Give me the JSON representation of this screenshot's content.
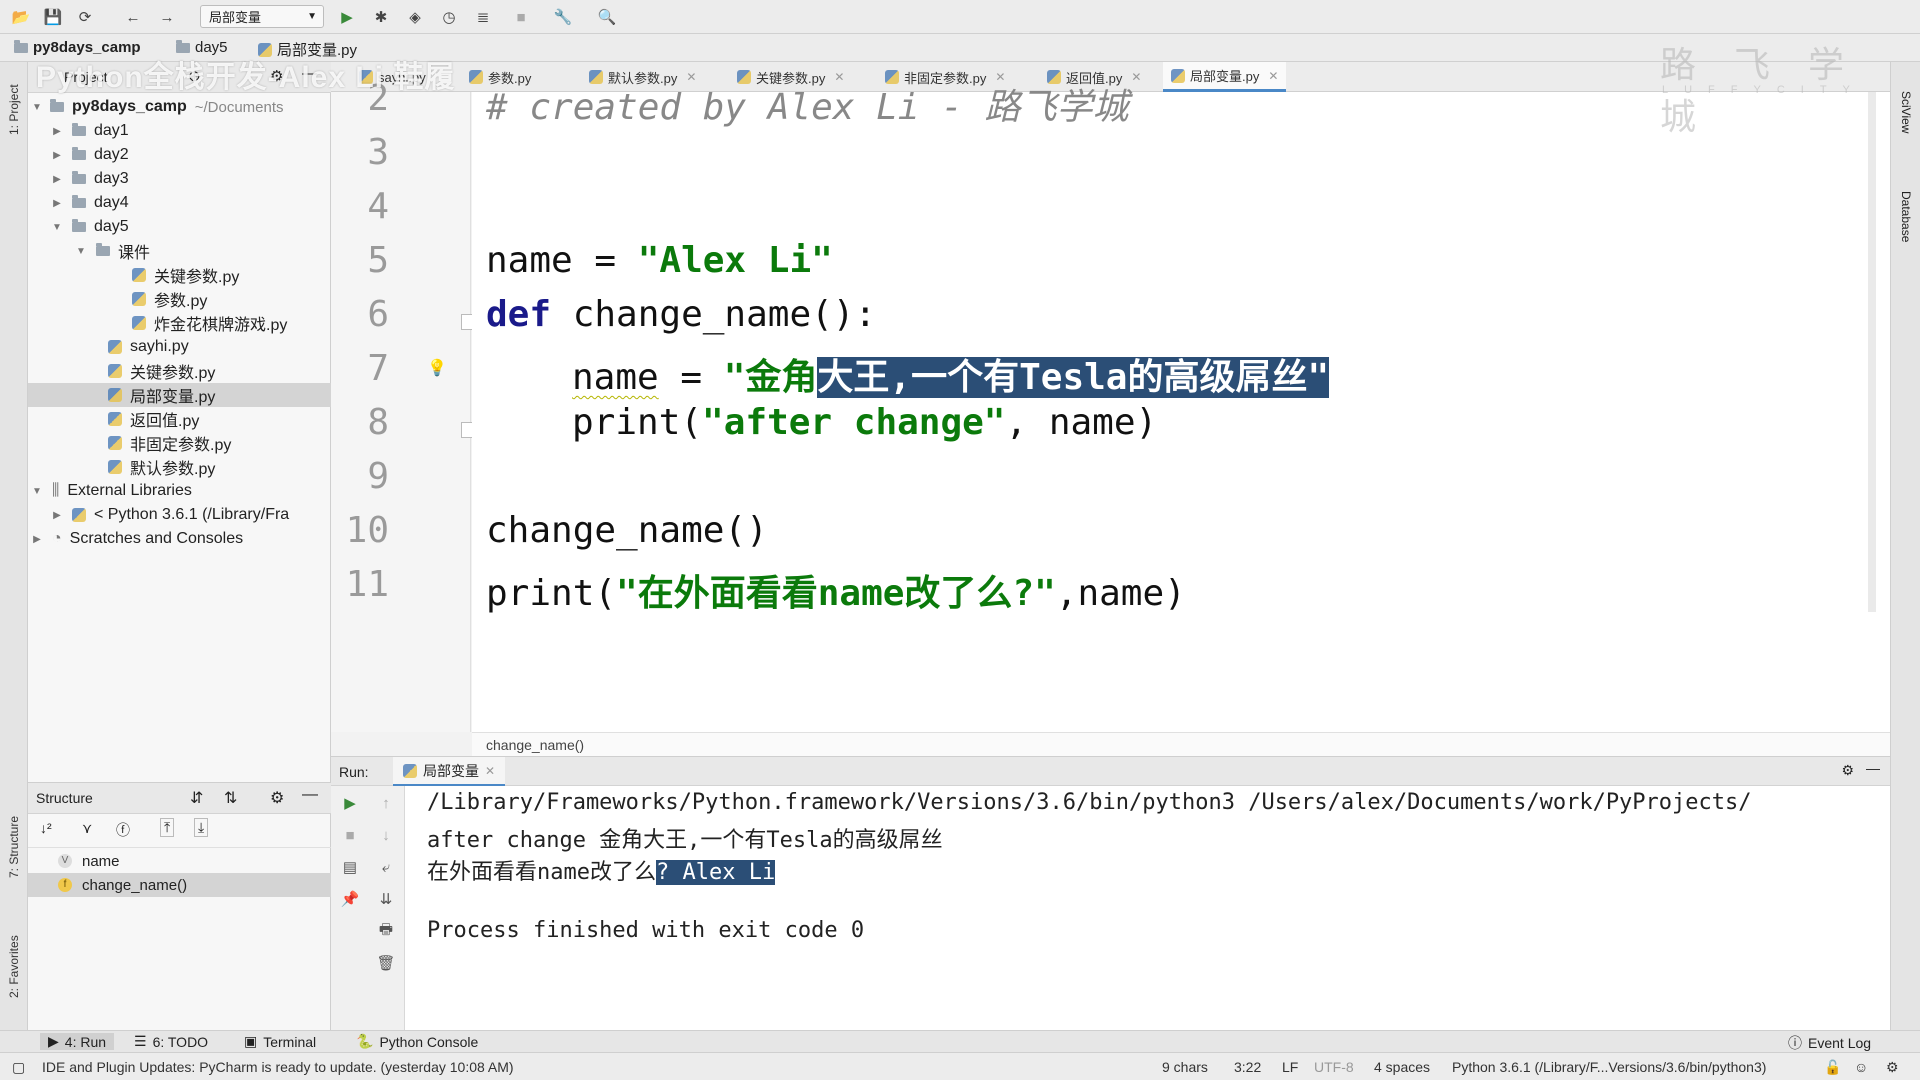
{
  "toolbar": {
    "run_config": "局部变量",
    "icons": [
      "open-folder-icon",
      "save-icon",
      "sync-icon",
      "back-icon",
      "forward-icon",
      "run-icon",
      "debug-icon",
      "coverage-icon",
      "profile-icon",
      "concurrency-icon",
      "stop-icon",
      "settings-wrench-icon",
      "search-icon"
    ]
  },
  "breadcrumb": {
    "project": "py8days_camp",
    "folder": "day5",
    "file": "局部变量.py"
  },
  "watermark": {
    "title": "Python全栈开发-Alex Li 鞋履",
    "logo": "路 飞 学 城",
    "logo_sub": "LUFFYCITY"
  },
  "project_panel": {
    "header": "Project",
    "tree": [
      {
        "label": "py8days_camp",
        "extra": "~/Documents"
      },
      {
        "label": "day1"
      },
      {
        "label": "day2"
      },
      {
        "label": "day3"
      },
      {
        "label": "day4"
      },
      {
        "label": "day5"
      },
      {
        "label": "课件"
      },
      {
        "label": "关键参数.py"
      },
      {
        "label": "参数.py"
      },
      {
        "label": "炸金花棋牌游戏.py"
      },
      {
        "label": "sayhi.py"
      },
      {
        "label": "关键参数.py"
      },
      {
        "label": "局部变量.py"
      },
      {
        "label": "返回值.py"
      },
      {
        "label": "非固定参数.py"
      },
      {
        "label": "默认参数.py"
      },
      {
        "label": "External Libraries"
      },
      {
        "label": "< Python 3.6.1 (/Library/Fra"
      },
      {
        "label": "Scratches and Consoles"
      }
    ]
  },
  "structure_panel": {
    "header": "Structure",
    "items": [
      {
        "badge": "V",
        "label": "name"
      },
      {
        "badge": "f",
        "label": "change_name()"
      }
    ]
  },
  "editor_tabs": [
    {
      "label": "sayhi.py"
    },
    {
      "label": "参数.py"
    },
    {
      "label": "默认参数.py"
    },
    {
      "label": "关键参数.py"
    },
    {
      "label": "非固定参数.py"
    },
    {
      "label": "返回值.py"
    },
    {
      "label": "局部变量.py",
      "active": true
    }
  ],
  "editor": {
    "line_numbers": [
      "2",
      "3",
      "4",
      "5",
      "6",
      "7",
      "8",
      "9",
      "10",
      "11"
    ],
    "comment": "# created by Alex Li - 路飞学城",
    "l5_name": "name",
    "l5_eq": " = ",
    "l5_str": "\"Alex Li\"",
    "l6_def": "def",
    "l6_rest": " change_name():",
    "l7_name": "name",
    "l7_eq": " = ",
    "l7_str_a": "\"金角",
    "l7_str_b": "大王,一个有Tesla的高级屌丝\"",
    "l8_print": "print(",
    "l8_str": "\"after change\"",
    "l8_rest": ", name)",
    "l10": "change_name()",
    "l11_print": "print(",
    "l11_str": "\"在外面看看name改了么?\"",
    "l11_rest": ",name)",
    "breadcrumb_fn": "change_name()"
  },
  "run_panel": {
    "label": "Run:",
    "tab": "局部变量",
    "output": [
      "/Library/Frameworks/Python.framework/Versions/3.6/bin/python3 /Users/alex/Documents/work/PyProjects/",
      "after change 金角大王,一个有Tesla的高级屌丝",
      "在外面看看name改了么",
      "? Alex Li",
      "",
      "Process finished with exit code 0"
    ]
  },
  "bottom_tools": [
    {
      "label": "4: Run"
    },
    {
      "label": "6: TODO"
    },
    {
      "label": "Terminal"
    },
    {
      "label": "Python Console"
    },
    {
      "label": "Event Log"
    }
  ],
  "left_stripe": {
    "project": "1: Project",
    "structure": "7: Structure",
    "favorites": "2: Favorites"
  },
  "right_stripe": {
    "sciview": "SciView",
    "database": "Database"
  },
  "status_bar": {
    "message": "IDE and Plugin Updates: PyCharm is ready to update. (yesterday 10:08 AM)",
    "chars": "9 chars",
    "position": "3:22",
    "line_sep": "LF",
    "encoding": "UTF-8",
    "indent": "4 spaces",
    "interpreter": "Python 3.6.1 (/Library/F...Versions/3.6/bin/python3)"
  },
  "colors": {
    "selection": "#2b4e76",
    "string": "#0b7a0b",
    "keyword": "#1a1a8a",
    "active_tab_underline": "#4a88c7"
  }
}
